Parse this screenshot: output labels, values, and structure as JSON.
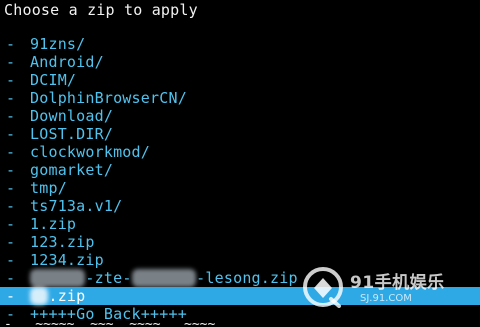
{
  "screen": {
    "title": "Choose a zip to apply",
    "bullet": "-",
    "items": [
      {
        "label": "91zns/",
        "selected": false
      },
      {
        "label": "Android/",
        "selected": false
      },
      {
        "label": "DCIM/",
        "selected": false
      },
      {
        "label": "DolphinBrowserCN/",
        "selected": false
      },
      {
        "label": "Download/",
        "selected": false
      },
      {
        "label": "LOST.DIR/",
        "selected": false
      },
      {
        "label": "clockworkmod/",
        "selected": false
      },
      {
        "label": "gomarket/",
        "selected": false
      },
      {
        "label": "tmp/",
        "selected": false
      },
      {
        "label": "ts713a.v1/",
        "selected": false
      },
      {
        "label": "1.zip",
        "selected": false
      },
      {
        "label": "123.zip",
        "selected": false
      },
      {
        "label": "1234.zip",
        "selected": false
      },
      {
        "label_parts": [
          "-zte-",
          "-lesong.zip"
        ],
        "selected": false
      },
      {
        "label_parts": [
          ".zip"
        ],
        "selected": true
      },
      {
        "label": "+++++Go Back+++++",
        "selected": false
      }
    ]
  },
  "watermark": {
    "brand": "91手机娱乐",
    "url": "SJ.91.COM"
  },
  "colors": {
    "background": "#000000",
    "title_text": "#f2f2f2",
    "item_text": "#4fc3ee",
    "selection_bar": "#2fa9e6",
    "selected_text": "#ffffff"
  }
}
